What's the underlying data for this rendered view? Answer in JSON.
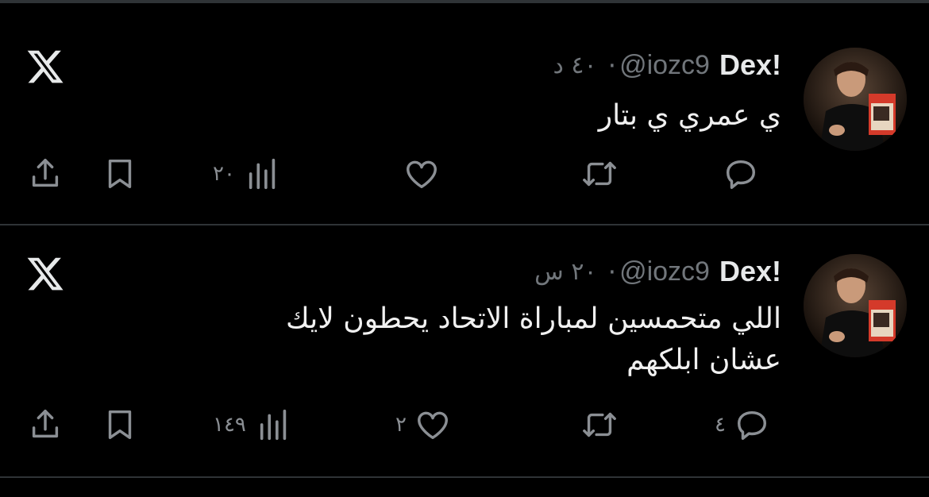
{
  "tweets": [
    {
      "name": "Dex!",
      "handle": "@iozc9",
      "dot": "·",
      "time": "٤٠ د",
      "text_lines": [
        "ي عمري ي بتار"
      ],
      "views": "٢٠",
      "likes": "",
      "reposts": "",
      "replies": ""
    },
    {
      "name": "Dex!",
      "handle": "@iozc9",
      "dot": "·",
      "time": "٢٠ س",
      "text_lines": [
        "اللي متحمسين لمباراة الاتحاد يحطون لايك",
        "عشان ابلكهم"
      ],
      "views": "١٤٩",
      "likes": "٢",
      "reposts": "",
      "replies": "٤"
    }
  ],
  "icons": {
    "platform": "x-logo-icon",
    "share": "share-icon",
    "bookmark": "bookmark-icon",
    "views": "views-bar-chart-icon",
    "like": "heart-icon",
    "repost": "repost-icon",
    "reply": "reply-bubble-icon"
  },
  "colors": {
    "background": "#000000",
    "text": "#e7e9ea",
    "muted": "#71767b",
    "divider": "#2f3336"
  }
}
